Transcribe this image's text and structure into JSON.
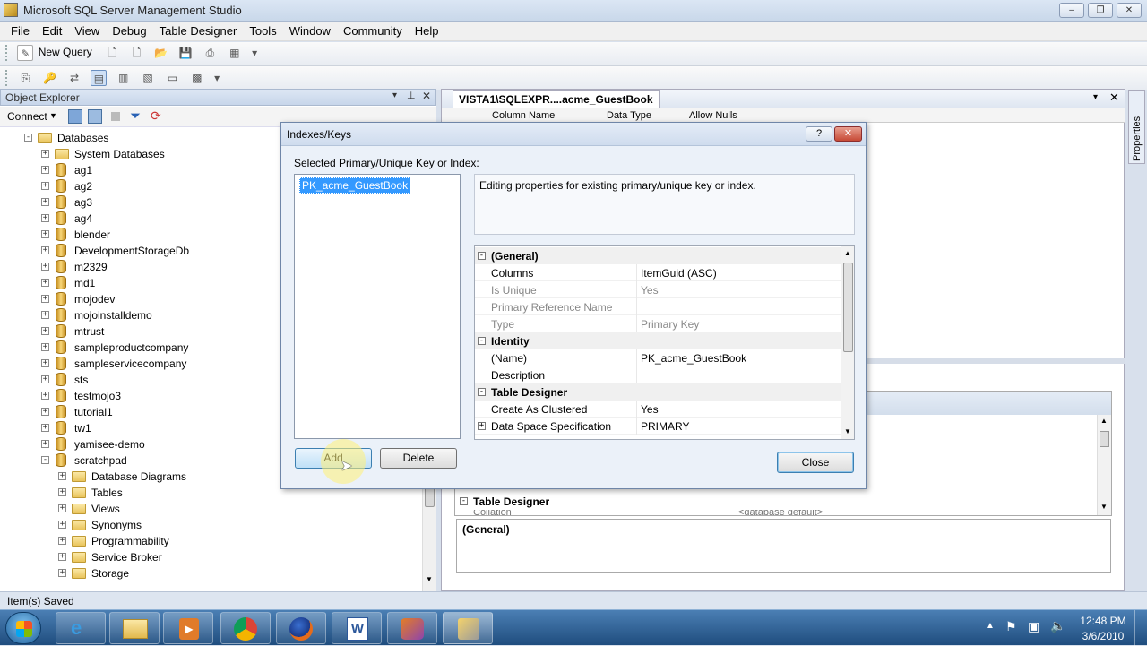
{
  "window": {
    "title": "Microsoft SQL Server Management Studio"
  },
  "menu": [
    "File",
    "Edit",
    "View",
    "Debug",
    "Table Designer",
    "Tools",
    "Window",
    "Community",
    "Help"
  ],
  "toolbar": {
    "new_query": "New Query"
  },
  "object_explorer": {
    "title": "Object Explorer",
    "connect": "Connect",
    "tree": [
      {
        "label": "Databases",
        "level": 0,
        "icon": "folder",
        "exp": "-"
      },
      {
        "label": "System Databases",
        "level": 1,
        "icon": "folder",
        "exp": "+"
      },
      {
        "label": "ag1",
        "level": 1,
        "icon": "db",
        "exp": "+"
      },
      {
        "label": "ag2",
        "level": 1,
        "icon": "db",
        "exp": "+"
      },
      {
        "label": "ag3",
        "level": 1,
        "icon": "db",
        "exp": "+"
      },
      {
        "label": "ag4",
        "level": 1,
        "icon": "db",
        "exp": "+"
      },
      {
        "label": "blender",
        "level": 1,
        "icon": "db",
        "exp": "+"
      },
      {
        "label": "DevelopmentStorageDb",
        "level": 1,
        "icon": "db",
        "exp": "+"
      },
      {
        "label": "m2329",
        "level": 1,
        "icon": "db",
        "exp": "+"
      },
      {
        "label": "md1",
        "level": 1,
        "icon": "db",
        "exp": "+"
      },
      {
        "label": "mojodev",
        "level": 1,
        "icon": "db",
        "exp": "+"
      },
      {
        "label": "mojoinstalldemo",
        "level": 1,
        "icon": "db",
        "exp": "+"
      },
      {
        "label": "mtrust",
        "level": 1,
        "icon": "db",
        "exp": "+"
      },
      {
        "label": "sampleproductcompany",
        "level": 1,
        "icon": "db",
        "exp": "+"
      },
      {
        "label": "sampleservicecompany",
        "level": 1,
        "icon": "db",
        "exp": "+"
      },
      {
        "label": "sts",
        "level": 1,
        "icon": "db",
        "exp": "+"
      },
      {
        "label": "testmojo3",
        "level": 1,
        "icon": "db",
        "exp": "+"
      },
      {
        "label": "tutorial1",
        "level": 1,
        "icon": "db",
        "exp": "+"
      },
      {
        "label": "tw1",
        "level": 1,
        "icon": "db",
        "exp": "+"
      },
      {
        "label": "yamisee-demo",
        "level": 1,
        "icon": "db",
        "exp": "+"
      },
      {
        "label": "scratchpad",
        "level": 1,
        "icon": "db",
        "exp": "-"
      },
      {
        "label": "Database Diagrams",
        "level": 2,
        "icon": "folder",
        "exp": "+"
      },
      {
        "label": "Tables",
        "level": 2,
        "icon": "folder",
        "exp": "+"
      },
      {
        "label": "Views",
        "level": 2,
        "icon": "folder",
        "exp": "+"
      },
      {
        "label": "Synonyms",
        "level": 2,
        "icon": "folder",
        "exp": "+"
      },
      {
        "label": "Programmability",
        "level": 2,
        "icon": "folder",
        "exp": "+"
      },
      {
        "label": "Service Broker",
        "level": 2,
        "icon": "folder",
        "exp": "+"
      },
      {
        "label": "Storage",
        "level": 2,
        "icon": "folder",
        "exp": "+"
      }
    ]
  },
  "doc": {
    "tab": "VISTA1\\SQLEXPR....acme_GuestBook",
    "columns": [
      "Column Name",
      "Data Type",
      "Allow Nulls"
    ],
    "props_category": "Table Designer",
    "props_row": "Collation",
    "props_row_value": "<database default>",
    "desc_title": "(General)"
  },
  "dialog": {
    "title": "Indexes/Keys",
    "help": "?",
    "list_label": "Selected Primary/Unique Key or Index:",
    "items": [
      "PK_acme_GuestBook"
    ],
    "description": "Editing properties for existing primary/unique key or index.",
    "props": [
      {
        "type": "cat",
        "label": "(General)",
        "exp": "-"
      },
      {
        "type": "row",
        "label": "Columns",
        "value": "ItemGuid (ASC)",
        "grey": false
      },
      {
        "type": "row",
        "label": "Is Unique",
        "value": "Yes",
        "grey": true
      },
      {
        "type": "row",
        "label": "Primary Reference Name",
        "value": "",
        "grey": true
      },
      {
        "type": "row",
        "label": "Type",
        "value": "Primary Key",
        "grey": true
      },
      {
        "type": "cat",
        "label": "Identity",
        "exp": "-"
      },
      {
        "type": "row",
        "label": "(Name)",
        "value": "PK_acme_GuestBook",
        "grey": false
      },
      {
        "type": "row",
        "label": "Description",
        "value": "",
        "grey": false
      },
      {
        "type": "cat",
        "label": "Table Designer",
        "exp": "-"
      },
      {
        "type": "row",
        "label": "Create As Clustered",
        "value": "Yes",
        "grey": false
      },
      {
        "type": "row",
        "label": "Data Space Specification",
        "value": "PRIMARY",
        "grey": false,
        "exp": "+"
      }
    ],
    "add": "Add",
    "delete": "Delete",
    "close": "Close"
  },
  "properties_tab": "Properties",
  "status": "Item(s) Saved",
  "clock": {
    "time": "12:48 PM",
    "date": "3/6/2010"
  }
}
